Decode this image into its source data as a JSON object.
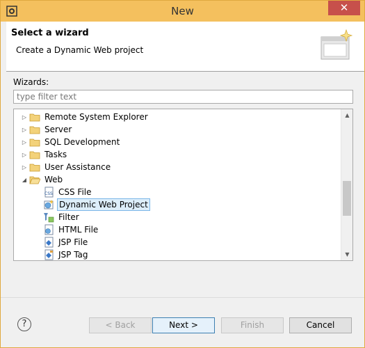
{
  "window": {
    "title": "New",
    "close_label": "✕"
  },
  "header": {
    "title": "Select a wizard",
    "description": "Create a Dynamic Web project"
  },
  "wizards": {
    "label": "Wizards:",
    "filter_placeholder": "type filter text",
    "tree": [
      {
        "label": "Remote System Explorer",
        "level": 0,
        "expanded": false,
        "icon": "folder-icon"
      },
      {
        "label": "Server",
        "level": 0,
        "expanded": false,
        "icon": "folder-icon"
      },
      {
        "label": "SQL Development",
        "level": 0,
        "expanded": false,
        "icon": "folder-icon"
      },
      {
        "label": "Tasks",
        "level": 0,
        "expanded": false,
        "icon": "folder-icon"
      },
      {
        "label": "User Assistance",
        "level": 0,
        "expanded": false,
        "icon": "folder-icon"
      },
      {
        "label": "Web",
        "level": 0,
        "expanded": true,
        "icon": "folder-open-icon"
      },
      {
        "label": "CSS File",
        "level": 1,
        "icon": "css-file-icon"
      },
      {
        "label": "Dynamic Web Project",
        "level": 1,
        "selected": true,
        "icon": "web-project-icon"
      },
      {
        "label": "Filter",
        "level": 1,
        "icon": "filter-icon"
      },
      {
        "label": "HTML File",
        "level": 1,
        "icon": "html-file-icon"
      },
      {
        "label": "JSP File",
        "level": 1,
        "icon": "jsp-file-icon"
      },
      {
        "label": "JSP Tag",
        "level": 1,
        "icon": "jsp-tag-icon"
      }
    ]
  },
  "buttons": {
    "back": "< Back",
    "next": "Next >",
    "finish": "Finish",
    "cancel": "Cancel",
    "help": "?"
  }
}
